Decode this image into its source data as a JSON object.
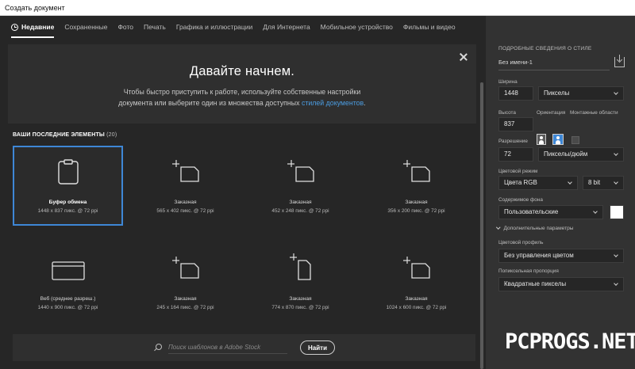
{
  "window": {
    "title": "Создать документ"
  },
  "tabs": [
    {
      "label": "Недавние",
      "active": true
    },
    {
      "label": "Сохраненные",
      "active": false
    },
    {
      "label": "Фото",
      "active": false
    },
    {
      "label": "Печать",
      "active": false
    },
    {
      "label": "Графика и иллюстрации",
      "active": false
    },
    {
      "label": "Для Интернета",
      "active": false
    },
    {
      "label": "Мобильное устройство",
      "active": false
    },
    {
      "label": "Фильмы и видео",
      "active": false
    }
  ],
  "welcome": {
    "title": "Давайте начнем.",
    "line1": "Чтобы быстро приступить к работе, используйте собственные настройки",
    "line2_prefix": "документа или выберите один из множества доступных ",
    "link": "стилей документов",
    "line2_suffix": "."
  },
  "recent": {
    "title": "ВАШИ ПОСЛЕДНИЕ ЭЛЕМЕНТЫ",
    "count": "(20)",
    "items": [
      {
        "name": "Буфер обмена",
        "info": "1448 x 837 пикс. @ 72 ppi",
        "icon": "clipboard-icon"
      },
      {
        "name": "Заказная",
        "info": "565 x 402 пикс. @ 72 ppi",
        "icon": "custom-landscape-icon"
      },
      {
        "name": "Заказная",
        "info": "452 x 248 пикс. @ 72 ppi",
        "icon": "custom-landscape-icon"
      },
      {
        "name": "Заказная",
        "info": "356 x 200 пикс. @ 72 ppi",
        "icon": "custom-landscape-icon"
      },
      {
        "name": "Веб (среднее разреш.)",
        "info": "1440 x 900 пикс. @ 72 ppi",
        "icon": "browser-window-icon"
      },
      {
        "name": "Заказная",
        "info": "245 x 164 пикс. @ 72 ppi",
        "icon": "custom-landscape-icon"
      },
      {
        "name": "Заказная",
        "info": "774 x 870 пикс. @ 72 ppi",
        "icon": "custom-portrait-icon"
      },
      {
        "name": "Заказная",
        "info": "1024 x 600 пикс. @ 72 ppi",
        "icon": "custom-landscape-icon"
      }
    ]
  },
  "search": {
    "placeholder": "Поиск шаблонов в Adobe Stock",
    "button": "Найти"
  },
  "panel": {
    "title": "ПОДРОБНЫЕ СВЕДЕНИЯ О СТИЛЕ",
    "preset_name": "Без имени-1",
    "width_label": "Ширина",
    "width_value": "1448",
    "width_unit": "Пикселы",
    "height_label": "Высота",
    "height_value": "837",
    "orientation_label": "Ориентация",
    "artboards_label": "Монтажные области",
    "resolution_label": "Разрешение",
    "resolution_value": "72",
    "resolution_unit": "Пикселы/дюйм",
    "color_mode_label": "Цветовой режим",
    "color_mode": "Цвета RGB",
    "bit_depth": "8 bit",
    "background_label": "Содержимое фона",
    "background": "Пользовательские",
    "background_color": "#ffffff",
    "advanced": "Дополнительные параметры",
    "color_profile_label": "Цветовой профиль",
    "color_profile": "Без управления цветом",
    "pixel_aspect_label": "Попиксельная пропорция",
    "pixel_aspect": "Квадратные пикселы"
  },
  "watermark": "PCPROGS.NET",
  "colors": {
    "accent": "#3e87d6",
    "link": "#4b9ce0",
    "panel": "#323232",
    "main": "#262626"
  }
}
